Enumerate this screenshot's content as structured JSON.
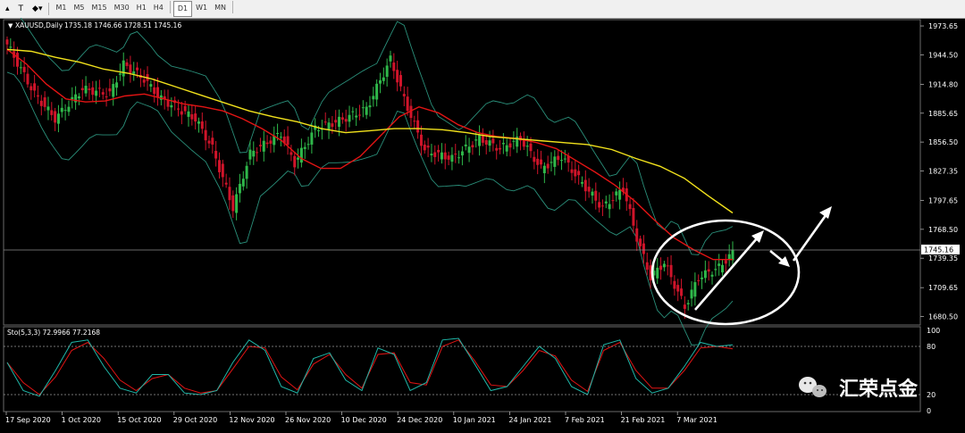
{
  "toolbar": {
    "icons": [
      "cursor-icon",
      "text-icon",
      "shapes-icon"
    ],
    "timeframes": [
      "M1",
      "M5",
      "M15",
      "M30",
      "H1",
      "H4",
      "D1",
      "W1",
      "MN"
    ],
    "active_timeframe": "D1"
  },
  "header": {
    "symbol": "XAUUSD,Daily",
    "ohlc": "1735.18 1746.66 1728.51 1745.16"
  },
  "stochastic": {
    "label": "Sto(5,3,3) 72.9966 77.2168",
    "levels": [
      "100",
      "80",
      "20",
      "0"
    ]
  },
  "watermark": {
    "text": "汇荣点金"
  },
  "chart_data": {
    "type": "candlestick",
    "price_axis_ticks": [
      "1973.65",
      "1944.50",
      "1914.80",
      "1885.65",
      "1856.50",
      "1827.35",
      "1797.65",
      "1768.50",
      "1739.35",
      "1709.65",
      "1680.50"
    ],
    "price_range": [
      1672,
      1980
    ],
    "current_price": "1745.16",
    "date_labels": [
      "17 Sep 2020",
      "1 Oct 2020",
      "15 Oct 2020",
      "29 Oct 2020",
      "12 Nov 2020",
      "26 Nov 2020",
      "10 Dec 2020",
      "24 Dec 2020",
      "10 Jan 2021",
      "24 Jan 2021",
      "7 Feb 2021",
      "21 Feb 2021",
      "7 Mar 2021"
    ],
    "ma_fast": [
      1950,
      1935,
      1915,
      1900,
      1897,
      1898,
      1903,
      1905,
      1900,
      1895,
      1892,
      1888,
      1880,
      1870,
      1858,
      1840,
      1830,
      1830,
      1842,
      1862,
      1882,
      1892,
      1886,
      1874,
      1866,
      1862,
      1860,
      1856,
      1850,
      1838,
      1826,
      1813,
      1797,
      1778,
      1760,
      1748,
      1738,
      1738
    ],
    "ma_slow": [
      1950,
      1948,
      1942,
      1937,
      1930,
      1926,
      1920,
      1912,
      1904,
      1896,
      1888,
      1882,
      1877,
      1870,
      1866,
      1868,
      1870,
      1870,
      1869,
      1866,
      1862,
      1860,
      1858,
      1856,
      1854,
      1849,
      1840,
      1832,
      1820,
      1802,
      1785
    ],
    "stoch_k": [
      60,
      25,
      18,
      50,
      85,
      88,
      55,
      28,
      22,
      45,
      45,
      22,
      20,
      25,
      60,
      88,
      75,
      30,
      22,
      65,
      72,
      38,
      25,
      78,
      70,
      25,
      35,
      88,
      90,
      58,
      25,
      30,
      55,
      80,
      65,
      30,
      20,
      82,
      88,
      40,
      22,
      28,
      55,
      85,
      80,
      82
    ],
    "stoch_d": [
      60,
      35,
      20,
      42,
      75,
      85,
      65,
      38,
      25,
      40,
      45,
      28,
      22,
      25,
      52,
      80,
      78,
      42,
      26,
      58,
      70,
      45,
      28,
      70,
      72,
      35,
      32,
      80,
      88,
      62,
      32,
      30,
      50,
      75,
      68,
      38,
      24,
      75,
      85,
      50,
      28,
      28,
      50,
      78,
      80,
      77
    ]
  }
}
